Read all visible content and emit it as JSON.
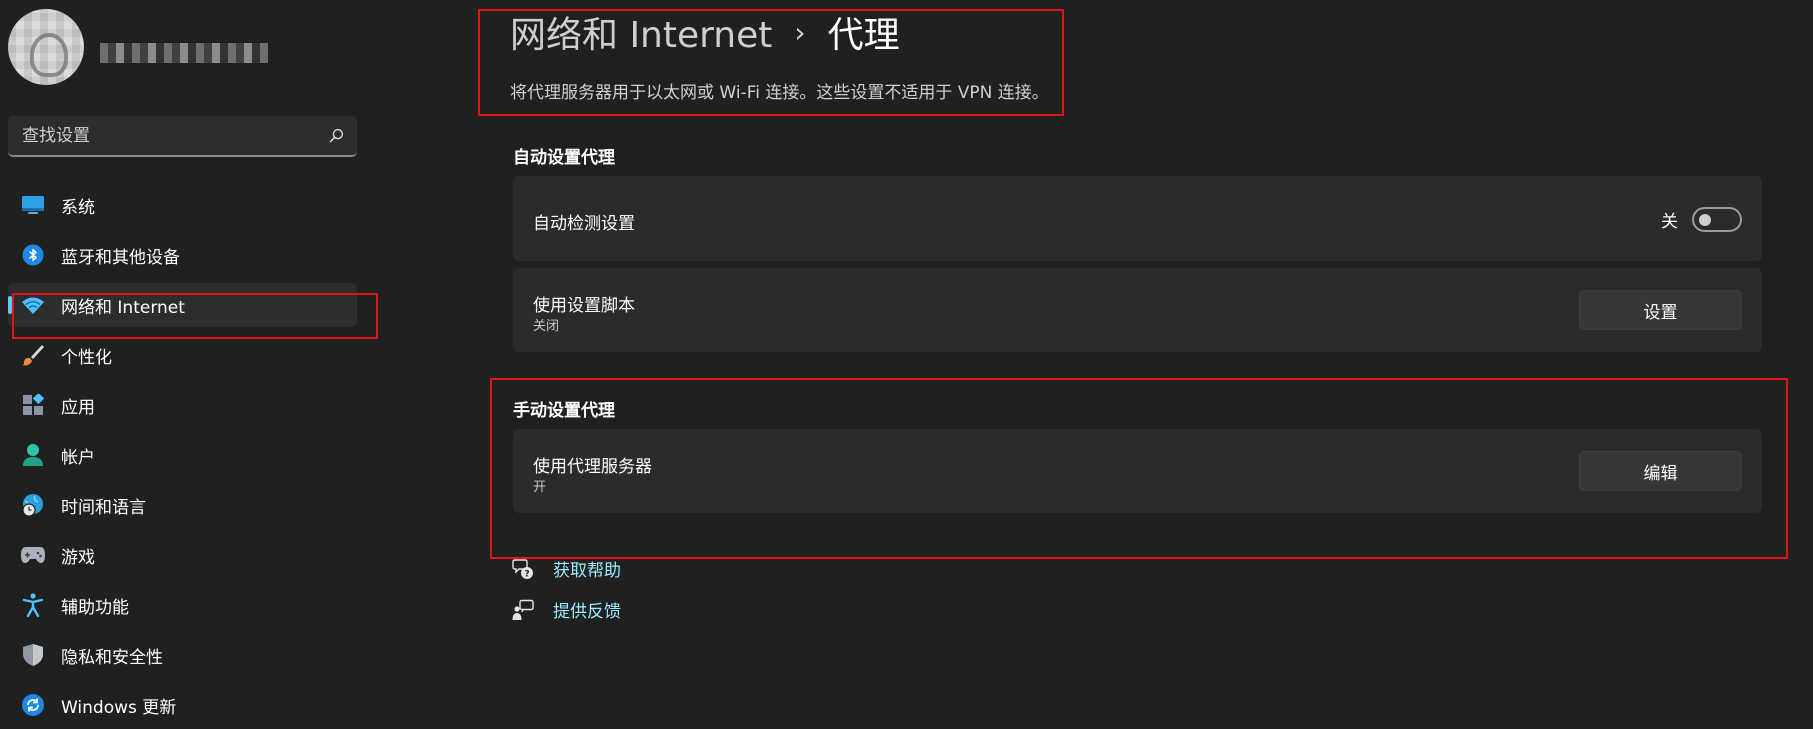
{
  "search": {
    "placeholder": "查找设置"
  },
  "sidebar": {
    "items": [
      {
        "label": "系统",
        "icon": "system-display-icon"
      },
      {
        "label": "蓝牙和其他设备",
        "icon": "bluetooth-icon"
      },
      {
        "label": "网络和 Internet",
        "icon": "wifi-icon",
        "active": true
      },
      {
        "label": "个性化",
        "icon": "brush-icon"
      },
      {
        "label": "应用",
        "icon": "apps-icon"
      },
      {
        "label": "帐户",
        "icon": "account-icon"
      },
      {
        "label": "时间和语言",
        "icon": "globe-clock-icon"
      },
      {
        "label": "游戏",
        "icon": "gamepad-icon"
      },
      {
        "label": "辅助功能",
        "icon": "accessibility-icon"
      },
      {
        "label": "隐私和安全性",
        "icon": "shield-icon"
      },
      {
        "label": "Windows 更新",
        "icon": "update-icon"
      }
    ]
  },
  "header": {
    "parent": "网络和 Internet",
    "separator": "›",
    "current": "代理",
    "description": "将代理服务器用于以太网或 Wi-Fi 连接。这些设置不适用于 VPN 连接。"
  },
  "auto_proxy": {
    "title": "自动设置代理",
    "detect": {
      "label": "自动检测设置",
      "state_label": "关",
      "on": false
    },
    "script": {
      "label": "使用设置脚本",
      "status": "关闭",
      "button": "设置"
    }
  },
  "manual_proxy": {
    "title": "手动设置代理",
    "server": {
      "label": "使用代理服务器",
      "status": "开",
      "button": "编辑"
    }
  },
  "links": {
    "help": "获取帮助",
    "feedback": "提供反馈"
  },
  "colors": {
    "background": "#202020",
    "card": "#2b2b2b",
    "accent": "#60cdff",
    "link": "#99ebff",
    "annotation": "#e0161b"
  }
}
